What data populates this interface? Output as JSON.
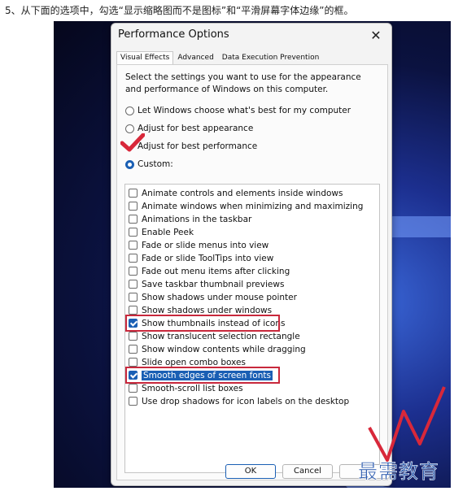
{
  "caption": "5、从下面的选项中，勾选“显示缩略图而不是图标”和“平滑屏幕字体边缘”的框。",
  "dialog": {
    "title": "Performance Options",
    "close_glyph": "✕",
    "tabs": [
      {
        "label": "Visual Effects",
        "active": true
      },
      {
        "label": "Advanced",
        "active": false
      },
      {
        "label": "Data Execution Prevention",
        "active": false
      }
    ],
    "description": "Select the settings you want to use for the appearance and performance of Windows on this computer.",
    "radios": [
      {
        "label": "Let Windows choose what's best for my computer",
        "selected": false
      },
      {
        "label": "Adjust for best appearance",
        "selected": false
      },
      {
        "label": "Adjust for best performance",
        "selected": false
      },
      {
        "label": "Custom:",
        "selected": true
      }
    ],
    "options": [
      {
        "label": "Animate controls and elements inside windows",
        "checked": false
      },
      {
        "label": "Animate windows when minimizing and maximizing",
        "checked": false
      },
      {
        "label": "Animations in the taskbar",
        "checked": false
      },
      {
        "label": "Enable Peek",
        "checked": false
      },
      {
        "label": "Fade or slide menus into view",
        "checked": false
      },
      {
        "label": "Fade or slide ToolTips into view",
        "checked": false
      },
      {
        "label": "Fade out menu items after clicking",
        "checked": false
      },
      {
        "label": "Save taskbar thumbnail previews",
        "checked": false
      },
      {
        "label": "Show shadows under mouse pointer",
        "checked": false
      },
      {
        "label": "Show shadows under windows",
        "checked": false
      },
      {
        "label": "Show thumbnails instead of icons",
        "checked": true
      },
      {
        "label": "Show translucent selection rectangle",
        "checked": false
      },
      {
        "label": "Show window contents while dragging",
        "checked": false
      },
      {
        "label": "Slide open combo boxes",
        "checked": false
      },
      {
        "label": "Smooth edges of screen fonts",
        "checked": true,
        "selected": true
      },
      {
        "label": "Smooth-scroll list boxes",
        "checked": false
      },
      {
        "label": "Use drop shadows for icon labels on the desktop",
        "checked": false
      }
    ],
    "buttons": {
      "ok": "OK",
      "cancel": "Cancel"
    }
  },
  "watermark": "最需教育",
  "colors": {
    "accent": "#1a5fb4",
    "highlight_box": "#c8283c",
    "annotation_red": "#d8283a"
  }
}
